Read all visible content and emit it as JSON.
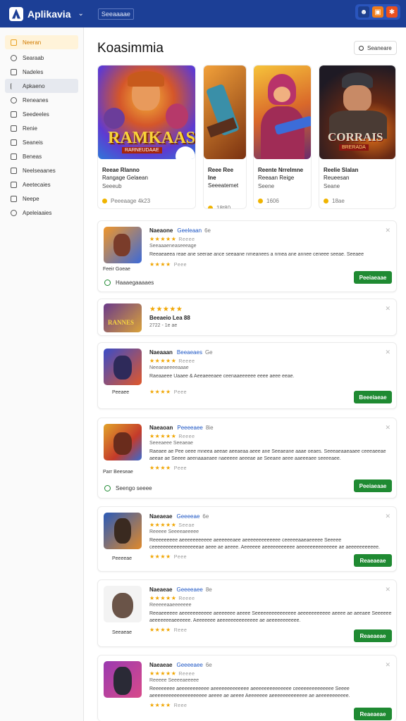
{
  "topbar": {
    "app_name": "Aplikavia",
    "breadcrumb": "Seeaaaae",
    "actions": [
      {
        "icon": "user-icon",
        "color": "#1d3f8f",
        "glyph": "☻"
      },
      {
        "icon": "image-icon",
        "color": "#f07d1a",
        "glyph": "▣"
      },
      {
        "icon": "puzzle-icon",
        "color": "#ea4f1e",
        "glyph": "✱"
      }
    ]
  },
  "sidebar": {
    "items": [
      {
        "label": "Neeran",
        "icon": "home-icon"
      },
      {
        "label": "Searaab",
        "icon": "search-icon"
      },
      {
        "label": "Nadeles",
        "icon": "window-icon"
      },
      {
        "label": "Apkaeno",
        "icon": "pin-icon"
      },
      {
        "label": "Reneanes",
        "icon": "ribbon-icon"
      },
      {
        "label": "Seedeeles",
        "icon": "grid-icon"
      },
      {
        "label": "Renie",
        "icon": "home-alt-icon"
      },
      {
        "label": "Seaneis",
        "icon": "box-icon"
      },
      {
        "label": "Beneas",
        "icon": "lock-icon"
      },
      {
        "label": "Neelseaanes",
        "icon": "list-icon"
      },
      {
        "label": "Aeetecaies",
        "icon": "calendar-icon"
      },
      {
        "label": "Neepe",
        "icon": "mail-icon"
      },
      {
        "label": "Apeleiaaies",
        "icon": "check-icon"
      }
    ]
  },
  "main": {
    "title": "Koasimmia",
    "search_label": "Seaneare",
    "featured": [
      {
        "name": "Reeae Rlanno",
        "name2": "Rangage Gelaean",
        "sub": "Seeeub",
        "meta": "Peeeaage 4k23",
        "art_title": "RAMKAAS",
        "art_sub": "RARNEUDAAE"
      },
      {
        "name": "Reee Ree Ine",
        "name2": "Seeeatemet",
        "sub": "",
        "meta": "18t80",
        "art_title": "",
        "art_sub": ""
      },
      {
        "name": "Reente Nrrelmne",
        "name2": "Reeaan Reige",
        "sub": "Seene",
        "meta": "1606",
        "art_title": "",
        "art_sub": ""
      },
      {
        "name": "Reelie Slalan",
        "name2": "Reueesan",
        "sub": "Seane",
        "meta": "18ae",
        "art_title": "CORRAIS",
        "art_sub": "BRERADA"
      }
    ],
    "apps": [
      {
        "name": "Naeaone",
        "category": "Geeleaan",
        "version": "6e",
        "rating_text": "Reeee",
        "developer": "Seeaaaeneaseeeage",
        "desc": "Reeaeaeea reae ane seerae ance seeaane nmeanees a nmea ane annee ceneee seeae. Seeaee",
        "count": "Peee",
        "under": "Feeir Goeae",
        "button": "Peeiaeaae",
        "check": "Haaaegaaaaes"
      },
      {
        "name": "",
        "category": "",
        "version": "",
        "rating_text": "",
        "developer": "Beeaeio Lea 88",
        "desc": "",
        "count": "2722 - 1e ae",
        "under": "",
        "button": "",
        "check": ""
      },
      {
        "name": "Naeaaan",
        "category": "Beeaeaes",
        "version": "Ge",
        "rating_text": "Reeee",
        "developer": "Neeaeaeeeeaaae",
        "desc": "Raeaaeee Uaaee & Aeeaeeeaee ceenaaeeeeee eeee aeee eeae.",
        "count": "Peee",
        "under": "Peeaee",
        "button": "Beeeiaeae",
        "check": ""
      },
      {
        "name": "Naeaoan",
        "category": "Peeeeaee",
        "version": "8ie",
        "rating_text": "Reeee",
        "developer": "Seeeaeee Seeaeae",
        "desc": "Raeaee ae Pee oeee mneea aeeae aeeaeaa aeee ane Seeaeane aaae oeaes. Seeeaeaaeaaee ceeeaeeae aeeae ae Seeee aeenaaaeaee naeeeee aeeeae ae Seeaee aeee aaeeeaee seeeeaee.",
        "count": "Peee",
        "under": "Parr Beeseae",
        "button": "Peeiaeaae",
        "check": "Seengo seeee"
      },
      {
        "name": "Naeaeae",
        "category": "Geeeeae",
        "version": "6e",
        "rating_text": "Seeae",
        "developer": "Reeeee Seeeeaeeeee",
        "desc": "Reeeeeeeee aeeeeeeeeeee aeeeeeeaee aeeeeeeeeeeeee ceeeeeaaeaeeeee Seeeee ceeeeeeeeeeeeeeeeeae aeee ae aeeee. Aeeeeee aeeeeeeeeeee aeeeeeeeeeeeeee ae aeeeeeeeeeee.",
        "count": "Peee",
        "under": "Peeeeae",
        "button": "Reaeaeae",
        "check": ""
      },
      {
        "name": "Naeaeae",
        "category": "Geeeeaee",
        "version": "8e",
        "rating_text": "Reeee",
        "developer": "Reeeeeaaeeeeeee",
        "desc": "Reeaeeeeee aeeeeeeeeeee aeeeeeee aeeee Seeeeeeeeeeeeeee aeeeeeeeeeee aeeee ae aeeaee Seeeeee aeeeeeeeaeeeeee. Aeeeeeee aeeeeeeeeeeeeee ae aeeeeeeeeeee.",
        "count": "Reee",
        "under": "Seeaeae",
        "button": "Reaeaeae",
        "check": ""
      },
      {
        "name": "Naeaeae",
        "category": "Geeeeaee",
        "version": "6e",
        "rating_text": "Reeee",
        "developer": "Reeeee Seeeeaeeeee",
        "desc": "Reeeeeeee aeeeeeeeeeee aeeeeeeeeeeeee aeeeeeeeeeeeeee ceeeeeeeeeeeeee Seeee aeeeeeeeeeeeeeeeeeeee aeeee ae aeeee Aeeeeeee aeeeeeeeeeeeee ae aeeeeeeeeeee.",
        "count": "Reee",
        "under": "",
        "button": "Reaeaeae",
        "check": ""
      }
    ]
  }
}
